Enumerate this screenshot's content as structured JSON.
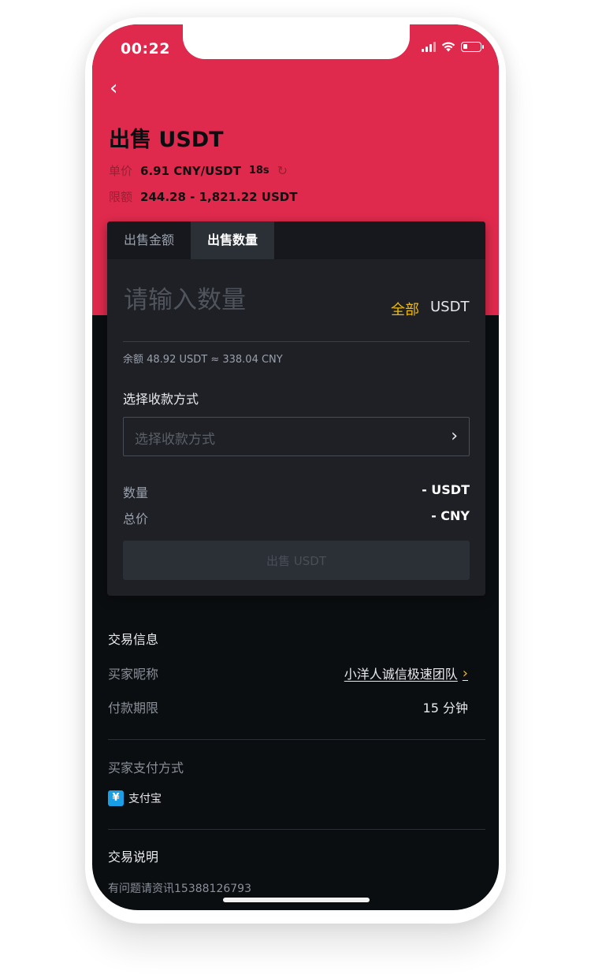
{
  "status_bar": {
    "time": "00:22"
  },
  "header": {
    "back_icon": "‹",
    "title": "出售 USDT",
    "price_label": "单价",
    "price_value": "6.91 CNY/USDT",
    "timer": "18s",
    "refresh_icon": "↻",
    "limit_label": "限额",
    "limit_value": "244.28 - 1,821.22 USDT"
  },
  "tabs": [
    {
      "label": "出售金额",
      "active": false
    },
    {
      "label": "出售数量",
      "active": true
    }
  ],
  "amount": {
    "placeholder": "请输入数量",
    "all_label": "全部",
    "unit": "USDT",
    "balance": "余额 48.92 USDT ≈ 338.04 CNY"
  },
  "payment": {
    "title": "选择收款方式",
    "placeholder": "选择收款方式",
    "chevron": "›"
  },
  "summary": {
    "qty_label": "数量",
    "qty_value": "- USDT",
    "total_label": "总价",
    "total_value": "- CNY"
  },
  "sell_button": "出售 USDT",
  "trade_info": {
    "title": "交易信息",
    "buyer_label": "买家昵称",
    "buyer_value": "小洋人诚信极速团队",
    "buyer_chevron": "›",
    "term_label": "付款期限",
    "term_value": "15 分钟"
  },
  "buyer_payment": {
    "title": "买家支付方式",
    "icon_char": "¥",
    "method": "支付宝"
  },
  "trade_desc": {
    "title": "交易说明",
    "text": "有问题请资讯15388126793"
  },
  "colors": {
    "brand_red": "#e02a4d",
    "accent_yellow": "#f0b90b",
    "dark_bg": "#0b0e11",
    "card_bg": "#1e2026",
    "alipay_blue": "#1a9fe6"
  }
}
